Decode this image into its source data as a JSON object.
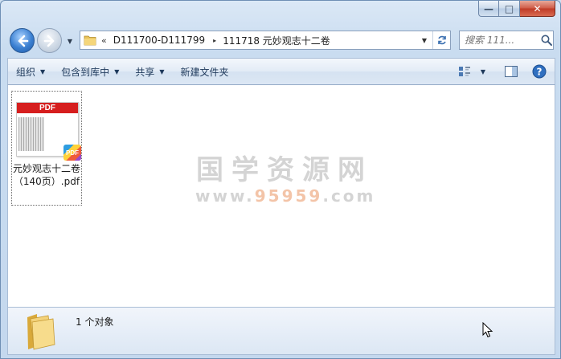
{
  "window": {
    "controls": {
      "minimize": "—",
      "maximize": "□",
      "close": "✕"
    }
  },
  "nav": {
    "back_icon": "arrow-left-icon",
    "forward_icon": "arrow-right-icon",
    "address": {
      "prefix": "«",
      "crumbs": [
        "D111700-D111799",
        "111718 元妙观志十二卷"
      ],
      "separator": "▸"
    },
    "search": {
      "placeholder": "搜索 111..."
    }
  },
  "toolbar": {
    "organize": "组织",
    "include_in_library": "包含到库中",
    "share": "共享",
    "new_folder": "新建文件夹"
  },
  "files": [
    {
      "thumb_header": "PDF",
      "badge": "PDF",
      "name": "元妙观志十二卷（140页）.pdf"
    }
  ],
  "watermark": {
    "title": "国学资源网",
    "url_pre": "www.",
    "url_mid": "95959",
    "url_post": ".com"
  },
  "status": {
    "text": "1 个对象"
  },
  "colors": {
    "accent": "#3a7fd1",
    "pdf_red": "#d61e1e",
    "watermark": "#d4d4d4"
  }
}
